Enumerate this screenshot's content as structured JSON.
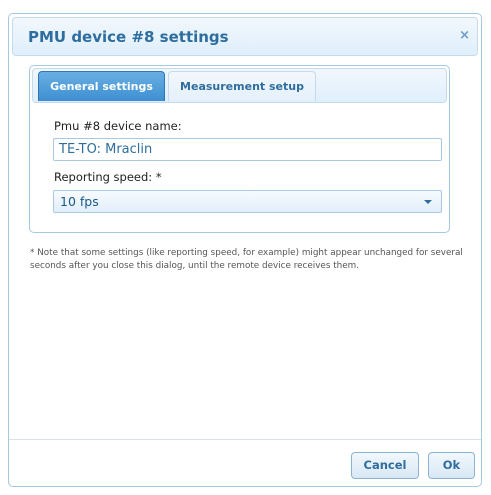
{
  "dialog": {
    "title": "PMU device #8 settings",
    "close_glyph": "×"
  },
  "tabs": [
    {
      "label": "General settings",
      "active": true
    },
    {
      "label": "Measurement setup",
      "active": false
    }
  ],
  "form": {
    "device_name_label": "Pmu #8 device name:",
    "device_name_value": "TE-TO: Mraclin",
    "reporting_speed_label": "Reporting speed: *",
    "reporting_speed_value": "10 fps"
  },
  "note": "* Note that some settings (like reporting speed, for example) might appear unchanged for several seconds after you close this dialog, until the remote device receives them.",
  "buttons": {
    "cancel": "Cancel",
    "ok": "Ok"
  },
  "colors": {
    "accent": "#2e6e9e",
    "active_tab": "#3d8fd2"
  },
  "icons": {
    "close": "close-icon",
    "dropdown": "chevron-down-icon"
  }
}
